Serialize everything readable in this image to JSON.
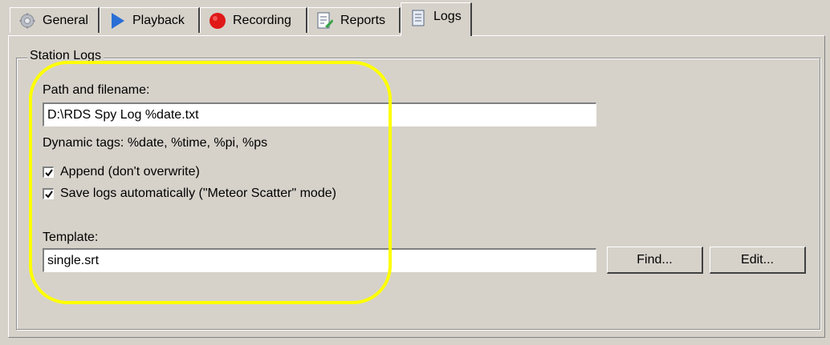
{
  "tabs": [
    {
      "label": "General",
      "icon": "gear-icon"
    },
    {
      "label": "Playback",
      "icon": "play-icon"
    },
    {
      "label": "Recording",
      "icon": "record-icon"
    },
    {
      "label": "Reports",
      "icon": "report-icon"
    },
    {
      "label": "Logs",
      "icon": "log-file-icon"
    }
  ],
  "active_tab": "Logs",
  "station_logs": {
    "title": "Station Logs",
    "path_label": "Path and filename:",
    "path_value": "D:\\RDS Spy Log %date.txt",
    "dynamic_tags": "Dynamic tags: %date, %time, %pi, %ps",
    "append_label": "Append (don't overwrite)",
    "append_checked": true,
    "autosave_label": "Save logs automatically (\"Meteor Scatter\" mode)",
    "autosave_checked": true,
    "template_label": "Template:",
    "template_value": "single.srt",
    "find_button": "Find...",
    "edit_button": "Edit..."
  },
  "colors": {
    "highlight": "#ffff00",
    "background": "#d6d2ca"
  }
}
